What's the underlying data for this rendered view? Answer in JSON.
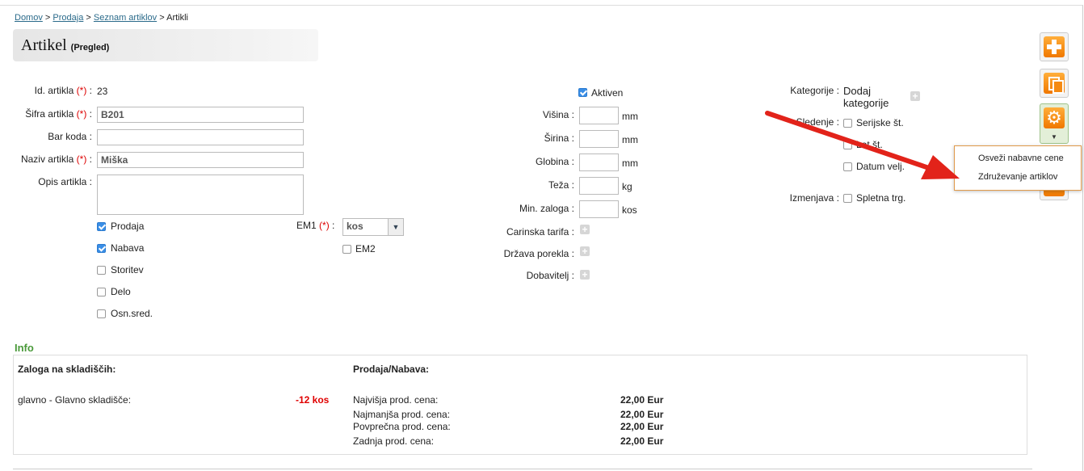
{
  "breadcrumb": {
    "items": [
      "Domov",
      "Prodaja",
      "Seznam artiklov"
    ],
    "current": "Artikli",
    "sep": ">"
  },
  "title": {
    "main": "Artikel",
    "sub": "(Pregled)"
  },
  "required_mark": "(*)",
  "left_form": {
    "id_label": "Id. artikla",
    "id_value": "23",
    "sifra_label": "Šifra artikla",
    "sifra_value": "B201",
    "barkoda_label": "Bar koda",
    "barkoda_value": "",
    "naziv_label": "Naziv artikla",
    "naziv_value": "Miška",
    "opis_label": "Opis artikla",
    "opis_value": ""
  },
  "types": [
    {
      "label": "Prodaja",
      "checked": true
    },
    {
      "label": "Nabava",
      "checked": true
    },
    {
      "label": "Storitev",
      "checked": false
    },
    {
      "label": "Delo",
      "checked": false
    },
    {
      "label": "Osn.sred.",
      "checked": false
    }
  ],
  "em1": {
    "label": "EM1",
    "value": "kos"
  },
  "em2": {
    "label": "EM2",
    "checked": false
  },
  "middle": {
    "aktiven_label": "Aktiven",
    "aktiven_checked": true,
    "visina_label": "Višina",
    "visina_unit": "mm",
    "sirina_label": "Širina",
    "sirina_unit": "mm",
    "globina_label": "Globina",
    "globina_unit": "mm",
    "teza_label": "Teža",
    "teza_unit": "kg",
    "minzaloga_label": "Min. zaloga",
    "minzaloga_unit": "kos",
    "carinska_label": "Carinska tarifa",
    "drzava_label": "Država porekla",
    "dobavitelj_label": "Dobavitelj"
  },
  "right": {
    "kategorije_label": "Kategorije",
    "kategorije_value_1": "Dodaj",
    "kategorije_value_2": "kategorije",
    "sledenje_label": "Sledenje",
    "sledenje_opts": [
      "Serijske št.",
      "Lot št.",
      "Datum velj."
    ],
    "izmenjava_label": "Izmenjava",
    "izmenjava_opt": "Spletna trg."
  },
  "dropdown_menu": {
    "items": [
      "Osveži nabavne cene",
      "Združevanje artiklov"
    ]
  },
  "info": {
    "heading": "Info",
    "stock_heading": "Zaloga na skladiščih:",
    "stock_location": "glavno - Glavno skladišče:",
    "stock_qty": "-12 kos",
    "sales_heading": "Prodaja/Nabava:",
    "prices": [
      {
        "label": "Najvišja prod. cena:",
        "value": "22,00 Eur"
      },
      {
        "label": "Najmanjša prod. cena:",
        "value": "22,00 Eur"
      },
      {
        "label": "Povprečna prod. cena:",
        "value": "22,00 Eur"
      },
      {
        "label": "Zadnja prod. cena:",
        "value": "22,00 Eur"
      }
    ]
  },
  "colors": {
    "accent_orange": "#f58a12",
    "required_red": "#dd0000",
    "info_green": "#4a9a3a",
    "negative_red": "#e00000",
    "arrow_red": "#e2231a"
  }
}
